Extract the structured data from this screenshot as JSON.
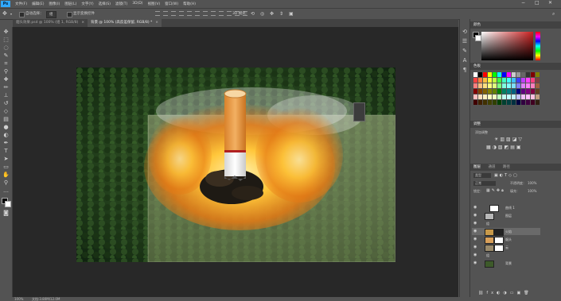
{
  "app": {
    "logo": "Ps"
  },
  "menu": {
    "items": [
      "文件(F)",
      "编辑(E)",
      "图像(I)",
      "图层(L)",
      "文字(Y)",
      "选择(S)",
      "滤镜(T)",
      "3D(D)",
      "视图(V)",
      "窗口(W)",
      "帮助(H)"
    ]
  },
  "window_controls": {
    "minimize": "−",
    "maximize": "□",
    "close": "✕"
  },
  "options": {
    "auto_select_label": "自动选择：",
    "auto_select_value": "组",
    "show_transform_label": "显示变换控件",
    "mode_label": "3D 模式："
  },
  "tabs": [
    {
      "label": "烟头效果.psd @ 100% (组 1, RGB/8)",
      "close": "×"
    },
    {
      "label": "背景 @ 100% (高反差保留, RGB/8) *",
      "close": "×"
    }
  ],
  "color_panel": {
    "title": "颜色",
    "accent": "#cc2020"
  },
  "swatches_panel": {
    "title": "色板"
  },
  "adjust_panel": {
    "title": "调整",
    "subtitle": "添加调整"
  },
  "layers_panel": {
    "tabs": [
      "图层",
      "通道",
      "路径"
    ],
    "kind_label": "类型",
    "blend_mode": "正常",
    "opacity_label": "不透明度：",
    "opacity_value": "100%",
    "lock_label": "锁定：",
    "fill_label": "填充：",
    "fill_value": "100%",
    "layers": [
      {
        "name": "曲线 1",
        "visible": true
      },
      {
        "name": "图层",
        "visible": true
      },
      {
        "name": "组",
        "visible": true
      },
      {
        "name": "火焰",
        "visible": true
      },
      {
        "name": "烟头",
        "visible": true
      },
      {
        "name": "云",
        "visible": true
      },
      {
        "name": "组",
        "visible": true
      },
      {
        "name": "背景",
        "visible": true
      }
    ]
  },
  "status": {
    "zoom": "100%",
    "doc_info": "文档:3.80M/12.0M"
  }
}
